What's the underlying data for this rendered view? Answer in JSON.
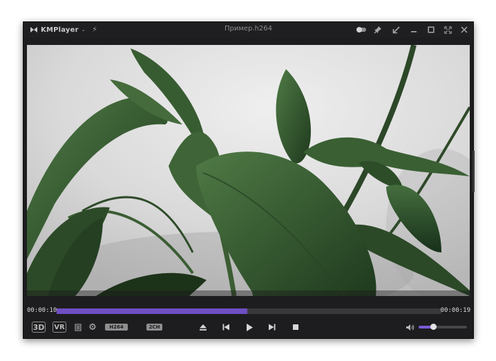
{
  "window": {
    "app_name": "KMPlayer",
    "app_menu_caret": "⌄",
    "title": "Пример.h264"
  },
  "titlebar_icons": {
    "bolt": "bolt-icon",
    "toggle": "toggle-icon",
    "pin": "pin-icon",
    "shrink": "shrink-arrow-icon",
    "minimize": "minimize-icon",
    "maximize": "maximize-icon",
    "fullscreen": "fullscreen-icon",
    "close": "close-icon"
  },
  "playback": {
    "elapsed": "00:00:10",
    "total": "00:00:19",
    "progress": 0.495
  },
  "controls": {
    "three_d_label": "3D",
    "vr_label": "VR",
    "codec_badge": "H264",
    "audio_badge": "2CH",
    "volume_level": 0.3
  },
  "colors": {
    "accent": "#6e4fc4",
    "window_bg": "#1d1d1f",
    "titlebar_bg": "#1f1f21",
    "text": "#dcdcdc"
  }
}
